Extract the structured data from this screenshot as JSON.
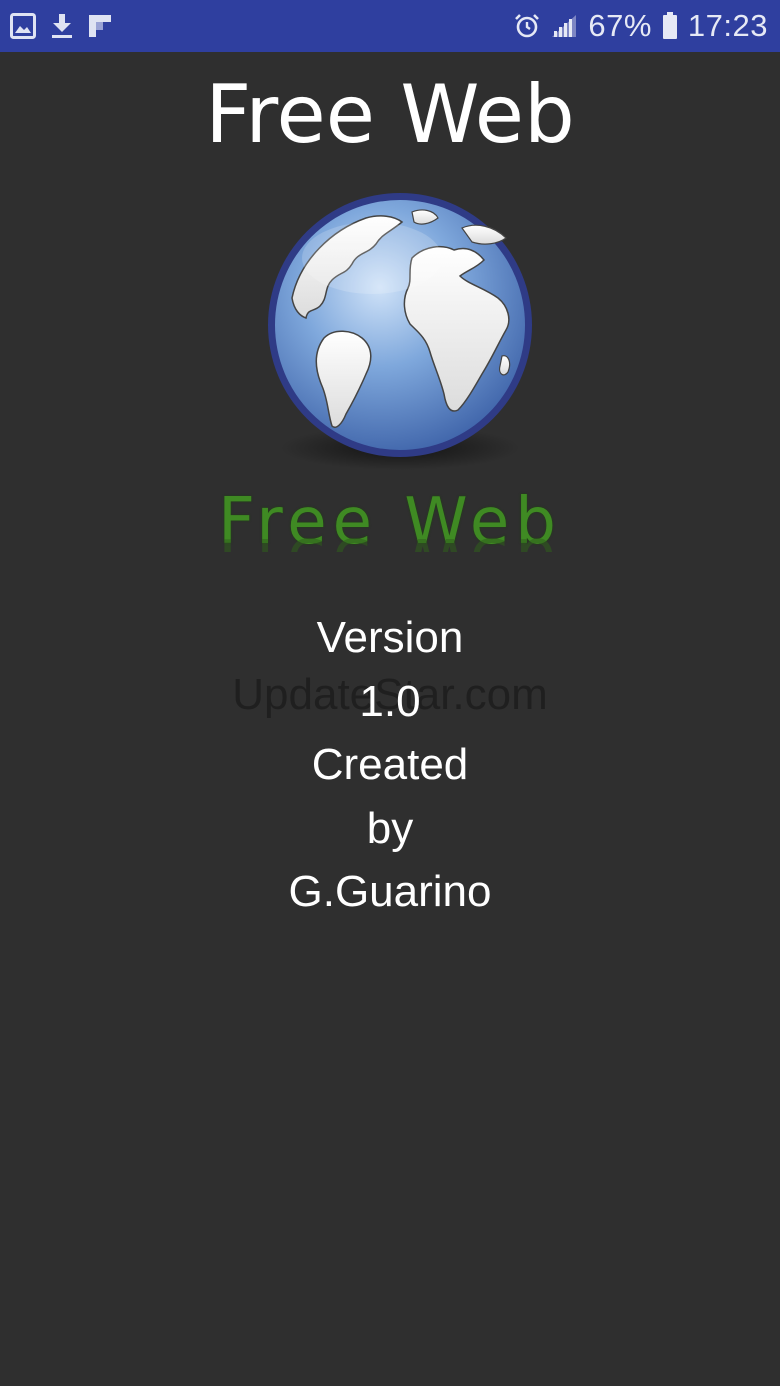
{
  "status_bar": {
    "battery_percent": "67%",
    "time": "17:23",
    "icons_left": [
      "image-icon",
      "download-icon",
      "flipboard-icon"
    ],
    "icons_right": [
      "alarm-icon",
      "signal-icon",
      "battery-icon"
    ]
  },
  "app": {
    "title": "Free Web",
    "logo_text": "Free Web"
  },
  "info": {
    "lines": [
      "Version",
      "1.0",
      "Created",
      "by",
      "G.Guarino"
    ]
  },
  "watermark": "UpdateStar.com",
  "colors": {
    "status_bar": "#2f3f9f",
    "background": "#2f2f2f",
    "logo_green": "#3f8a23"
  }
}
